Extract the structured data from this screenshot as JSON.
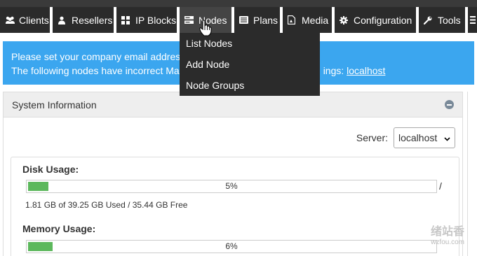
{
  "nav": {
    "items": [
      {
        "label": "Clients",
        "icon": "users-icon"
      },
      {
        "label": "Resellers",
        "icon": "user-icon"
      },
      {
        "label": "IP Blocks",
        "icon": "grid-icon"
      },
      {
        "label": "Nodes",
        "icon": "server-icon"
      },
      {
        "label": "Plans",
        "icon": "list-icon"
      },
      {
        "label": "Media",
        "icon": "file-icon"
      },
      {
        "label": "Configuration",
        "icon": "gear-icon"
      },
      {
        "label": "Tools",
        "icon": "wrench-icon"
      }
    ],
    "active": "Nodes"
  },
  "dropdown": {
    "items": [
      "List Nodes",
      "Add Node",
      "Node Groups"
    ]
  },
  "alert": {
    "line1": "Please set your company email address",
    "line2_prefix": "The following nodes have incorrect Ma",
    "line2_suffix": "ings: ",
    "link": "localhost"
  },
  "panel": {
    "title": "System Information",
    "server_label": "Server:",
    "server_value": "localhost"
  },
  "disk": {
    "label": "Disk Usage:",
    "percent": 5,
    "percent_text": "5%",
    "mount": "/",
    "detail": "1.81 GB of 39.25 GB Used / 35.44 GB Free"
  },
  "memory": {
    "label": "Memory Usage:",
    "percent": 6,
    "percent_text": "6%"
  },
  "watermark": {
    "text": "绪站香",
    "sub": "wzfou.com"
  },
  "colors": {
    "nav_bg": "#2b2b2b",
    "alert_bg": "#3ba6ef",
    "bar_fill": "#5cb85c"
  }
}
